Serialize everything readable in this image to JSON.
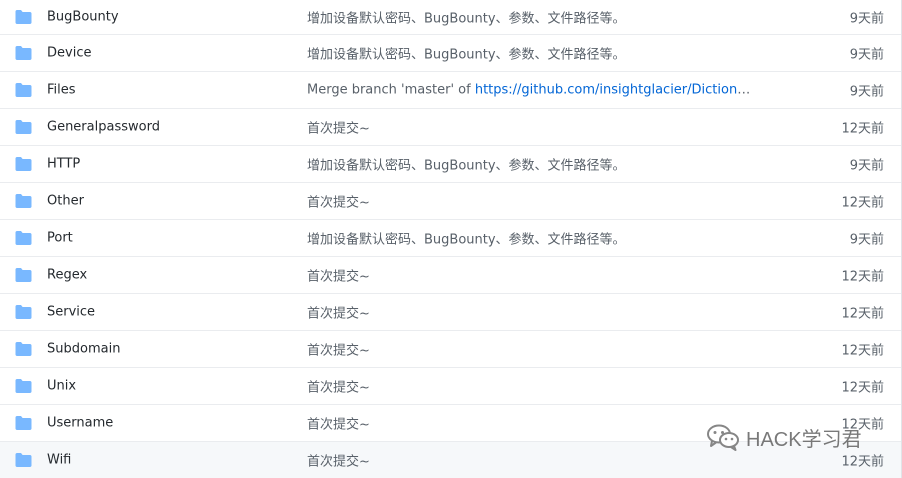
{
  "colors": {
    "folder": "#79b8ff",
    "link": "#0366d6",
    "text": "#24292e",
    "muted": "#586069",
    "border": "#eaecef"
  },
  "rows": [
    {
      "name": "BugBounty",
      "message": "增加设备默认密码、BugBounty、参数、文件路径等。",
      "age": "9天前",
      "icon": "folder-icon"
    },
    {
      "name": "Device",
      "message": "增加设备默认密码、BugBounty、参数、文件路径等。",
      "age": "9天前",
      "icon": "folder-icon"
    },
    {
      "name": "Files",
      "message_prefix": "Merge branch 'master' of ",
      "message_link": "https://github.com/insightglacier/Dictionary…",
      "age": "9天前",
      "icon": "folder-icon"
    },
    {
      "name": "Generalpassword",
      "message": "首次提交~",
      "age": "12天前",
      "icon": "folder-icon"
    },
    {
      "name": "HTTP",
      "message": "增加设备默认密码、BugBounty、参数、文件路径等。",
      "age": "9天前",
      "icon": "folder-icon"
    },
    {
      "name": "Other",
      "message": "首次提交~",
      "age": "12天前",
      "icon": "folder-icon"
    },
    {
      "name": "Port",
      "message": "增加设备默认密码、BugBounty、参数、文件路径等。",
      "age": "9天前",
      "icon": "folder-icon"
    },
    {
      "name": "Regex",
      "message": "首次提交~",
      "age": "12天前",
      "icon": "folder-icon"
    },
    {
      "name": "Service",
      "message": "首次提交~",
      "age": "12天前",
      "icon": "folder-icon"
    },
    {
      "name": "Subdomain",
      "message": "首次提交~",
      "age": "12天前",
      "icon": "folder-icon"
    },
    {
      "name": "Unix",
      "message": "首次提交~",
      "age": "12天前",
      "icon": "folder-icon"
    },
    {
      "name": "Username",
      "message": "首次提交~",
      "age": "12天前",
      "icon": "folder-icon"
    },
    {
      "name": "Wifi",
      "message": "首次提交~",
      "age": "12天前",
      "icon": "folder-icon"
    }
  ],
  "watermark": {
    "text": "HACK学习君",
    "icon": "wechat-icon"
  }
}
